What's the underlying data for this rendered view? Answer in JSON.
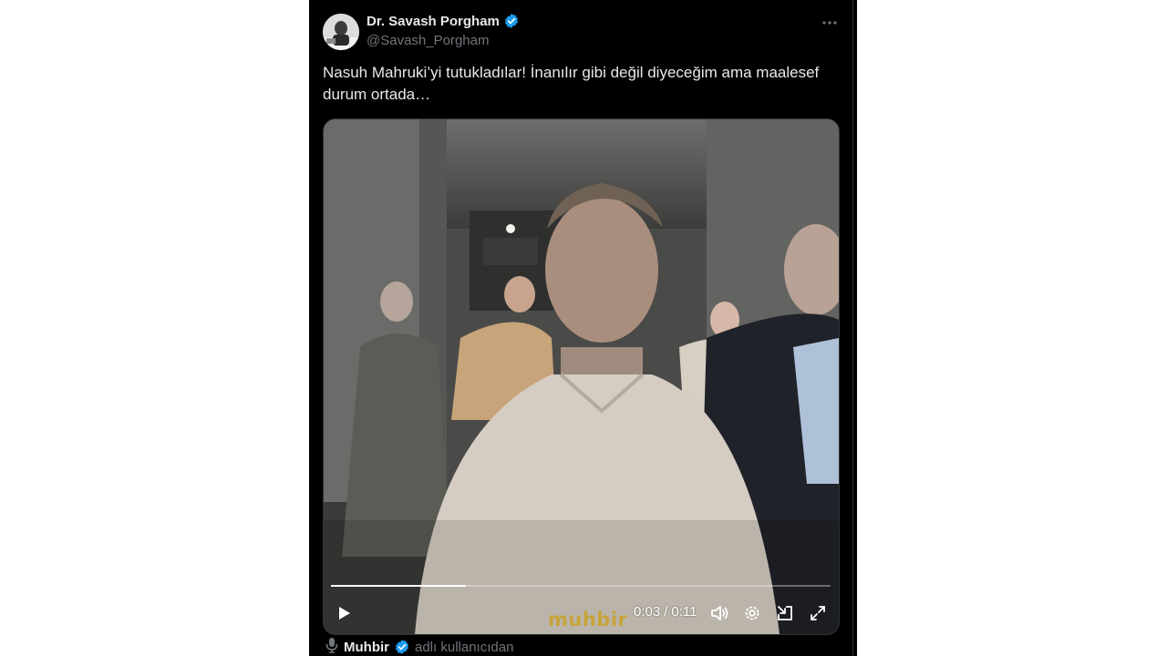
{
  "tweet": {
    "author": {
      "display_name": "Dr. Savash Porgham",
      "handle": "@Savash_Porgham",
      "verified_icon": "verified-badge-icon"
    },
    "more_icon": "more-horizontal-icon",
    "text": "Nasuh Mahruki’yi tutukladılar! İnanılır gibi değil diyeceğim ama maalesef durum ortada…"
  },
  "video": {
    "progress": 0.27,
    "current_time": "0:03",
    "separator": "/",
    "duration": "0:11",
    "watermark": "muhbir",
    "controls": [
      "play-icon",
      "volume-icon",
      "settings-icon",
      "pip-icon",
      "fullscreen-icon"
    ]
  },
  "attribution": {
    "source_name": "Muhbir",
    "suffix": "adlı kullanıcıdan"
  },
  "colors": {
    "background": "#000000",
    "text_primary": "#e7e9ea",
    "text_secondary": "#71767b",
    "verified": "#1d9bf0"
  }
}
